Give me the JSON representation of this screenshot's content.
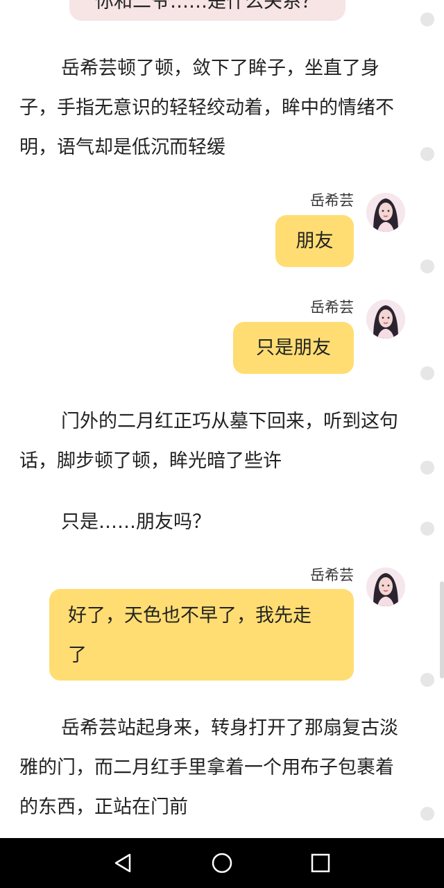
{
  "top_bubble_text": "你和二爷……是什么关系？",
  "speaker": "岳希芸",
  "narration_1": "岳希芸顿了顿，敛下了眸子，坐直了身子，手指无意识的轻轻绞动着，眸中的情绪不明，语气却是低沉而轻缓",
  "messages": [
    {
      "speaker": "岳希芸",
      "text": "朋友"
    },
    {
      "speaker": "岳希芸",
      "text": "只是朋友"
    },
    {
      "speaker": "岳希芸",
      "text": "好了，天色也不早了，我先走了"
    }
  ],
  "narration_2": "门外的二月红正巧从墓下回来，听到这句话，脚步顿了顿，眸光暗了些许",
  "narration_3": "只是……朋友吗？",
  "narration_4": "岳希芸站起身来，转身打开了那扇复古淡雅的门，而二月红手里拿着一个用布子包裹着的东西，正站在门前",
  "colors": {
    "bubble": "#ffdd73",
    "top_bubble": "#f7e4e4",
    "navbar": "#000000"
  },
  "nav": {
    "back_icon": "back-triangle-icon",
    "home_icon": "home-circle-icon",
    "recents_icon": "recents-square-icon"
  }
}
